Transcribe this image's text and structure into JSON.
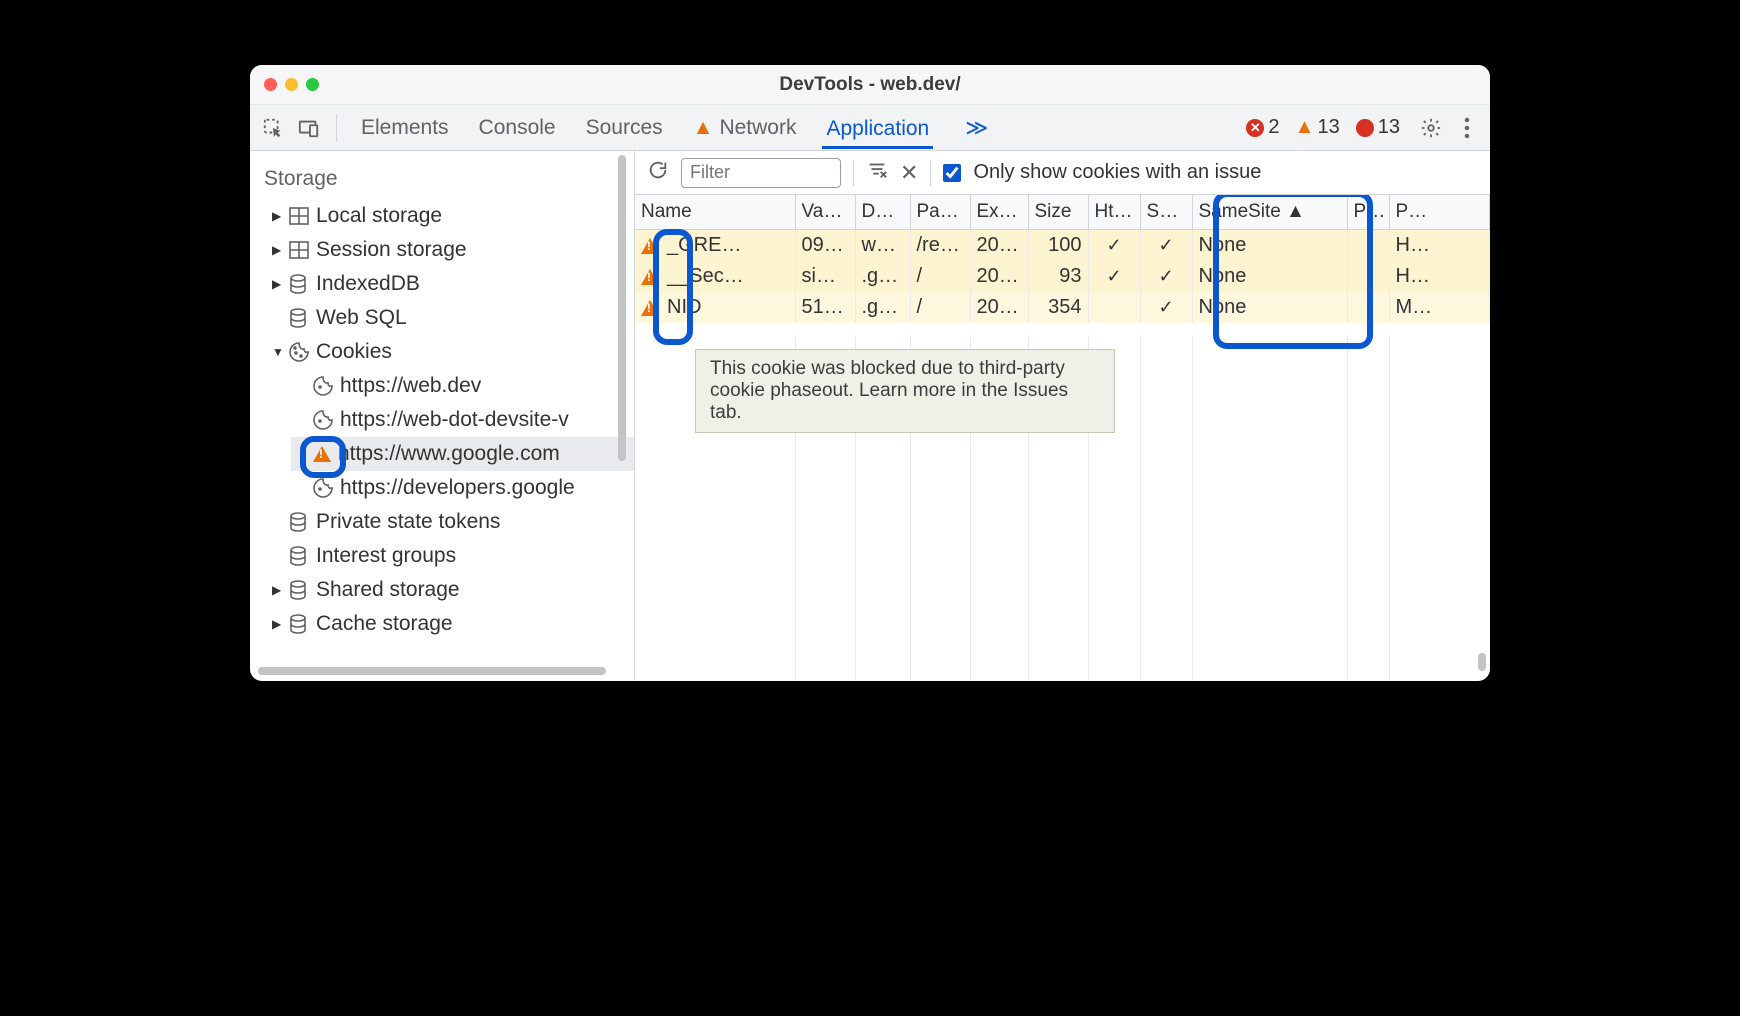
{
  "window": {
    "title": "DevTools - web.dev/"
  },
  "tabs": {
    "elements": "Elements",
    "console": "Console",
    "sources": "Sources",
    "network": "Network",
    "application": "Application",
    "more": "≫"
  },
  "counters": {
    "errors": "2",
    "warnings": "13",
    "messages": "13"
  },
  "sidebar": {
    "heading": "Storage",
    "items": {
      "local_storage": "Local storage",
      "session_storage": "Session storage",
      "indexeddb": "IndexedDB",
      "websql": "Web SQL",
      "cookies": "Cookies",
      "private_state_tokens": "Private state tokens",
      "interest_groups": "Interest groups",
      "shared_storage": "Shared storage",
      "cache_storage": "Cache storage"
    },
    "cookies_children": {
      "webdev": "https://web.dev",
      "devsite": "https://web-dot-devsite-v",
      "google": "https://www.google.com",
      "devgoogle": "https://developers.google"
    }
  },
  "toolbar": {
    "filter_placeholder": "Filter",
    "only_issues_label": "Only show cookies with an issue"
  },
  "columns": [
    "Name",
    "Va…",
    "D…",
    "Pa…",
    "Ex…",
    "Size",
    "Ht…",
    "Se…",
    "SameSite  ▲",
    "P…",
    "P…"
  ],
  "rows": [
    {
      "name": "_GRE…",
      "value": "09…",
      "domain": "w…",
      "path": "/re…",
      "expires": "20…",
      "size": "100",
      "http": "✓",
      "secure": "✓",
      "samesite": "None",
      "p1": "",
      "p2": "H…"
    },
    {
      "name": "__Sec…",
      "value": "si…",
      "domain": ".g…",
      "path": "/",
      "expires": "20…",
      "size": "93",
      "http": "✓",
      "secure": "✓",
      "samesite": "None",
      "p1": "",
      "p2": "H…"
    },
    {
      "name": "NID",
      "value": "51…",
      "domain": ".g…",
      "path": "/",
      "expires": "20…",
      "size": "354",
      "http": "",
      "secure": "✓",
      "samesite": "None",
      "p1": "",
      "p2": "M…"
    }
  ],
  "tooltip": "This cookie was blocked due to third-party cookie phaseout. Learn more in the Issues tab.",
  "icons": {
    "warn": "⚠"
  }
}
